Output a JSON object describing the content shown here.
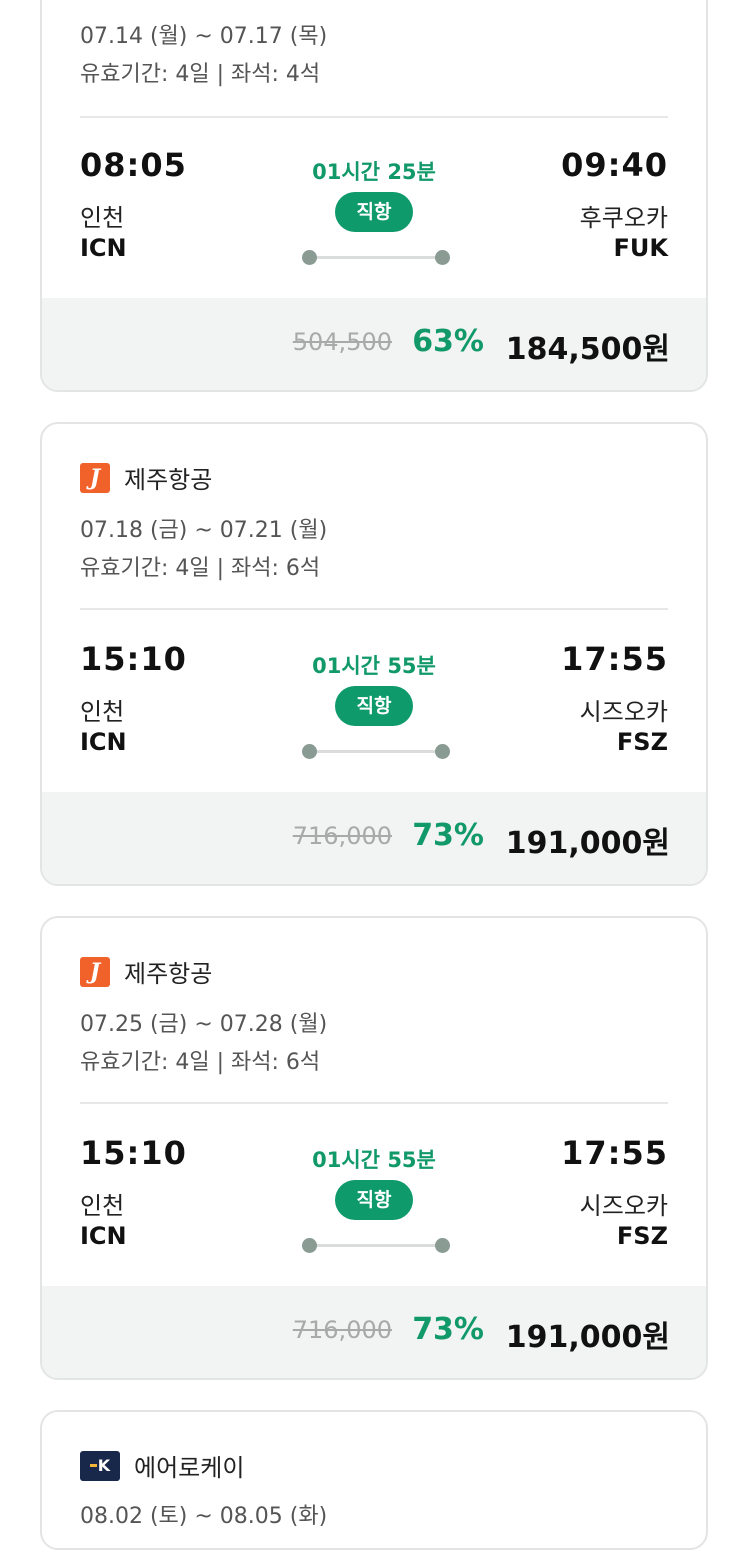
{
  "cards": [
    {
      "airline": "",
      "dates": "07.14 (월) ~ 07.17 (목)",
      "validity": "유효기간: 4일 | 좌석: 4석",
      "dep_time": "08:05",
      "dep_city": "인천",
      "dep_code": "ICN",
      "arr_time": "09:40",
      "arr_city": "후쿠오카",
      "arr_code": "FUK",
      "duration": "01시간 25분",
      "direct": "직항",
      "orig_price": "504,500",
      "discount": "63%",
      "price": "184,500원"
    },
    {
      "airline": "제주항공",
      "logo_icon": "jeju-air-logo-icon",
      "logo_text": "J",
      "dates": "07.18 (금) ~ 07.21 (월)",
      "validity": "유효기간: 4일 | 좌석: 6석",
      "dep_time": "15:10",
      "dep_city": "인천",
      "dep_code": "ICN",
      "arr_time": "17:55",
      "arr_city": "시즈오카",
      "arr_code": "FSZ",
      "duration": "01시간 55분",
      "direct": "직항",
      "orig_price": "716,000",
      "discount": "73%",
      "price": "191,000원"
    },
    {
      "airline": "제주항공",
      "logo_icon": "jeju-air-logo-icon",
      "logo_text": "J",
      "dates": "07.25 (금) ~ 07.28 (월)",
      "validity": "유효기간: 4일 | 좌석: 6석",
      "dep_time": "15:10",
      "dep_city": "인천",
      "dep_code": "ICN",
      "arr_time": "17:55",
      "arr_city": "시즈오카",
      "arr_code": "FSZ",
      "duration": "01시간 55분",
      "direct": "직항",
      "orig_price": "716,000",
      "discount": "73%",
      "price": "191,000원"
    },
    {
      "airline": "에어로케이",
      "logo_icon": "aerok-logo-icon",
      "logo_text": "K",
      "dates": "08.02 (토) ~ 08.05 (화)"
    }
  ],
  "colors": {
    "accent": "#0f9a6b",
    "jeju": "#f0622a",
    "aerok": "#17284a"
  }
}
